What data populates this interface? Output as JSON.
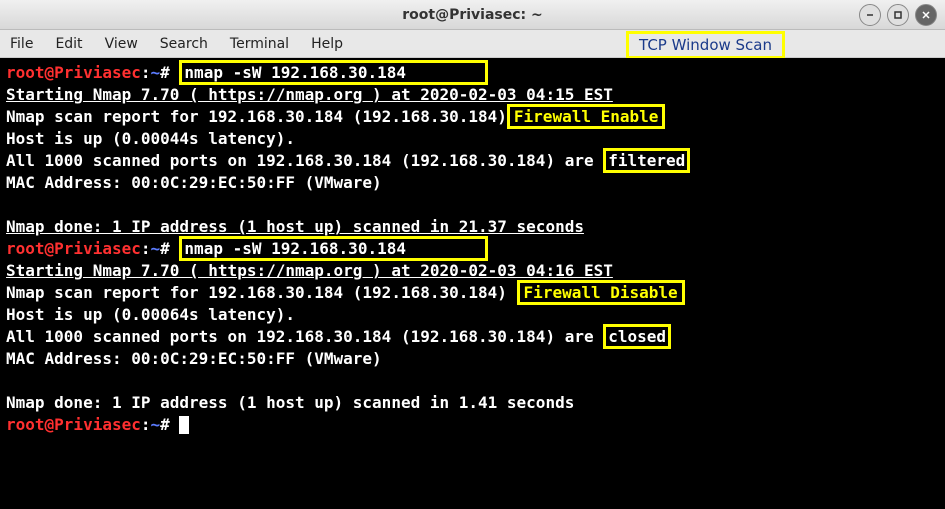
{
  "titlebar": {
    "title": "root@Priviasec: ~"
  },
  "menubar": {
    "items": [
      "File",
      "Edit",
      "View",
      "Search",
      "Terminal",
      "Help"
    ]
  },
  "annotations": {
    "scan_type": "TCP Window Scan",
    "firewall_enable": "Firewall Enable",
    "firewall_disable": "Firewall Disable",
    "filtered": "filtered",
    "closed": "closed"
  },
  "prompt": {
    "user_host": "root@Priviasec",
    "colon": ":",
    "path": "~",
    "hash": "#"
  },
  "cmd1": "nmap -sW 192.168.30.184",
  "cmd2": "nmap -sW 192.168.30.184",
  "run1": {
    "starting": "Starting Nmap 7.70 ( https://nmap.org ) at 2020-02-03 04:15 EST",
    "report": "Nmap scan report for 192.168.30.184 (192.168.30.184)",
    "host": "Host is up (0.00044s latency).",
    "ports_pre": "All 1000 scanned ports on 192.168.30.184 (192.168.30.184) are ",
    "mac": "MAC Address: 00:0C:29:EC:50:FF (VMware)",
    "done": "Nmap done: 1 IP address (1 host up) scanned in 21.37 seconds"
  },
  "run2": {
    "starting": "Starting Nmap 7.70 ( https://nmap.org ) at 2020-02-03 04:16 EST",
    "report_pre": "Nmap scan report for 192.168.30.184 (192.168.30.184) ",
    "host": "Host is up (0.00064s latency).",
    "ports_pre": "All 1000 scanned ports on 192.168.30.184 (192.168.30.184) are ",
    "mac": "MAC Address: 00:0C:29:EC:50:FF (VMware)",
    "done": "Nmap done: 1 IP address (1 host up) scanned in 1.41 seconds"
  }
}
